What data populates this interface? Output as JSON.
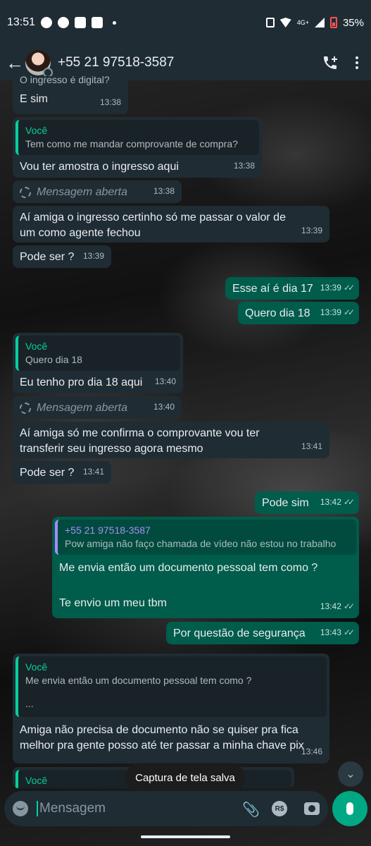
{
  "status_bar": {
    "time": "13:51",
    "network": "4G+",
    "battery": "35%"
  },
  "header": {
    "contact": "+55 21 97518-3587",
    "back_icon": "arrow-left-icon",
    "call_icon": "add-call-icon",
    "menu_icon": "more-vert-icon"
  },
  "messages": [
    {
      "dir": "in",
      "quote_text": "O ingresso é digital?",
      "text": "E sim",
      "time": "13:38"
    },
    {
      "dir": "in",
      "quote_name": "Você",
      "quote_text": "Tem como me mandar comprovante de compra?",
      "text": "Vou ter amostra o ingresso aqui",
      "time": "13:38"
    },
    {
      "dir": "in",
      "system": "Mensagem aberta",
      "time": "13:38"
    },
    {
      "dir": "in",
      "text": "Aí amiga o ingresso certinho só me passar o valor de um como agente fechou",
      "time": "13:39"
    },
    {
      "dir": "in",
      "text": "Pode ser ?",
      "time": "13:39"
    },
    {
      "dir": "out",
      "text": "Esse aí é dia 17",
      "time": "13:39"
    },
    {
      "dir": "out",
      "text": "Quero dia 18",
      "time": "13:39"
    },
    {
      "dir": "in",
      "quote_name": "Você",
      "quote_text": "Quero dia 18",
      "text": "Eu tenho pro dia 18 aqui",
      "time": "13:40"
    },
    {
      "dir": "in",
      "system": "Mensagem aberta",
      "time": "13:40"
    },
    {
      "dir": "in",
      "text": "Aí amiga só me confirma o comprovante vou ter transferir seu ingresso agora mesmo",
      "time": "13:41"
    },
    {
      "dir": "in",
      "text": "Pode ser ?",
      "time": "13:41"
    },
    {
      "dir": "out",
      "text": "Pode sim",
      "time": "13:42"
    },
    {
      "dir": "out",
      "quote_name": "+55 21 97518-3587",
      "quote_text": "Pow amiga não faço chamada de vídeo não estou no trabalho",
      "text": "Me envia então um documento pessoal tem como ?",
      "text2": "Te envio um meu tbm",
      "time": "13:42"
    },
    {
      "dir": "out",
      "text": "Por questão de segurança",
      "time": "13:43"
    },
    {
      "dir": "in",
      "quote_name": "Você",
      "quote_text": "Me envia então um documento pessoal tem como ?",
      "quote_text2": "...",
      "text": "Amiga não precisa de documento não se quiser pra fica melhor pra gente posso até ter passar a minha chave pix",
      "time": "13:46"
    },
    {
      "dir": "in",
      "quote_name": "Você"
    }
  ],
  "toast": "Captura de tela salva",
  "composer": {
    "placeholder": "Mensagem",
    "rs_label": "R$"
  }
}
